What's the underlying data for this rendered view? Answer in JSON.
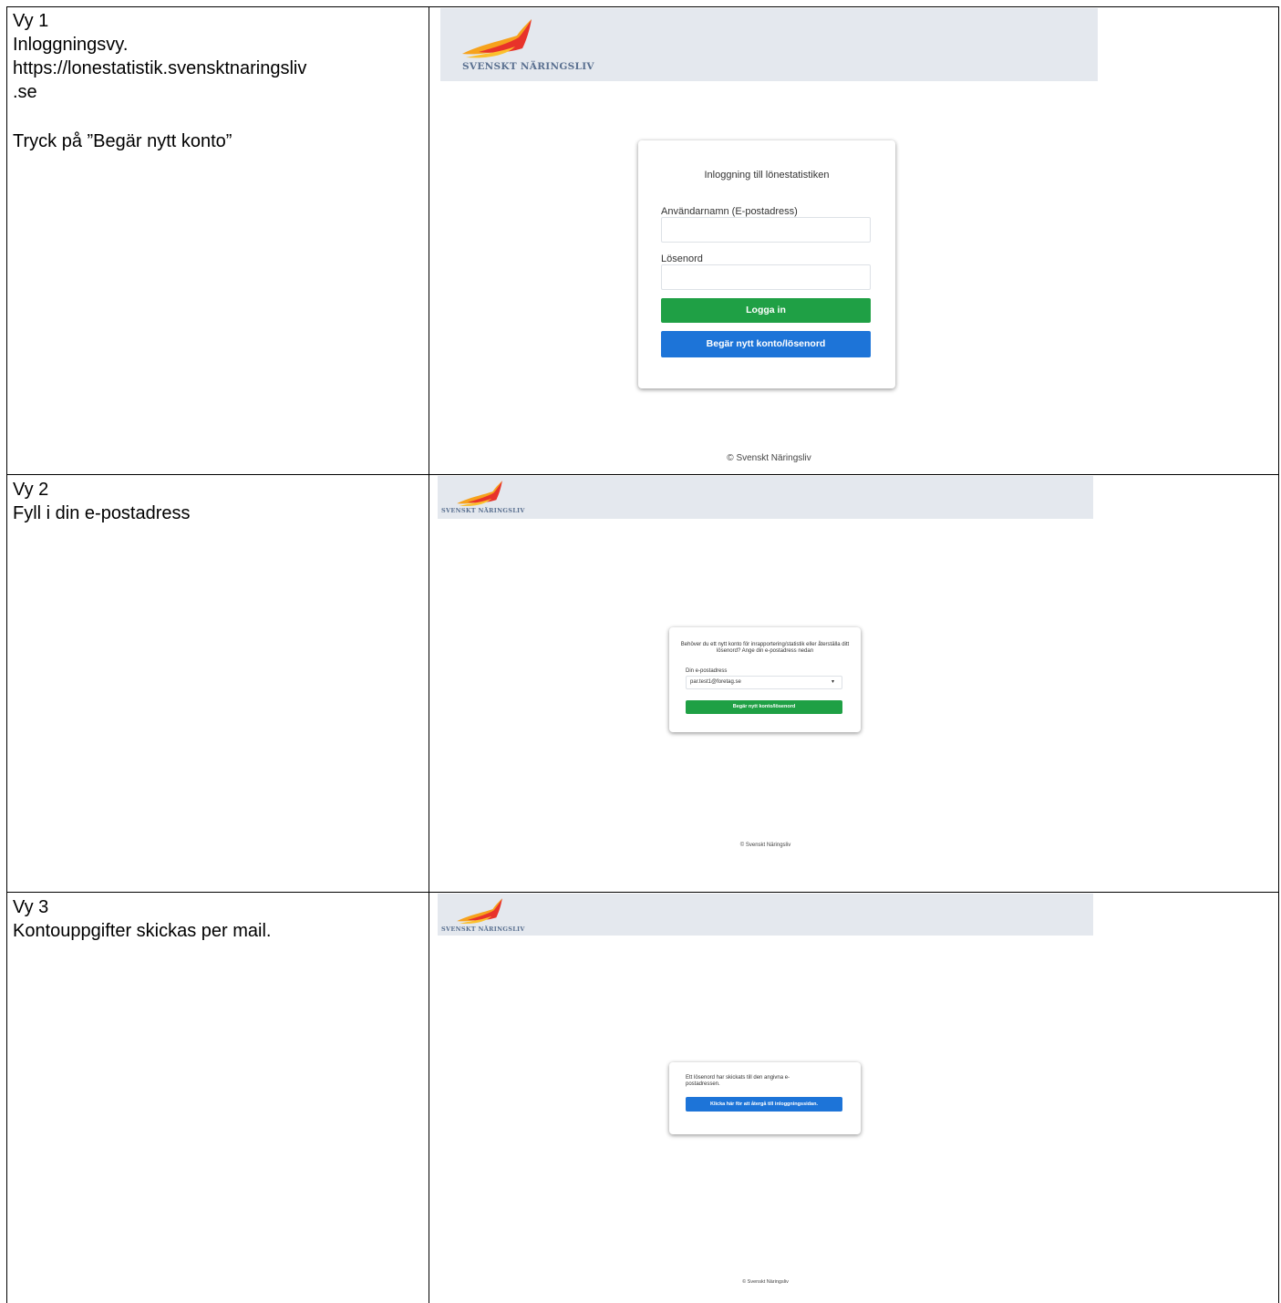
{
  "rows": [
    {
      "lines": [
        "Vy 1",
        "Inloggningsvy.",
        "https://lonestatistik.svensktnaringsliv",
        ".se",
        "",
        "Tryck på ”Begär nytt konto”"
      ]
    },
    {
      "lines": [
        "Vy 2",
        "Fyll i din e-postadress"
      ]
    },
    {
      "lines": [
        "Vy 3",
        "Kontouppgifter skickas per mail."
      ]
    }
  ],
  "brand": {
    "logo_text": "SVENSKT NÄRINGSLIV",
    "header_bg": "#e4e8ee"
  },
  "view1": {
    "card_title": "Inloggning till lönestatistiken",
    "username_label": "Användarnamn (E-postadress)",
    "password_label": "Lösenord",
    "login_button": "Logga in",
    "request_button": "Begär nytt konto/lösenord",
    "footer": "© Svenskt Näringsliv"
  },
  "view2": {
    "card_text": "Behöver du ett nytt konto för inrapportering/statistik eller återställa ditt lösenord? Ange din e-postadress nedan",
    "email_label": "Din e-postadress",
    "email_value": "par.test1@foretag.se",
    "request_button": "Begär nytt konto/lösenord",
    "footer": "© Svenskt Näringsliv"
  },
  "view3": {
    "card_text": "Ett lösenord har skickats till den angivna e-postadressen.",
    "back_button": "Klicka här för att återgå till inloggningssidan.",
    "footer": "© Svenskt Näringsliv"
  },
  "colors": {
    "green_button": "#1fa045",
    "blue_button": "#1d74d8"
  },
  "icons": {
    "logo": "svenskt-naringsliv-bird-logo",
    "dropdown": "chevron-down-icon"
  }
}
